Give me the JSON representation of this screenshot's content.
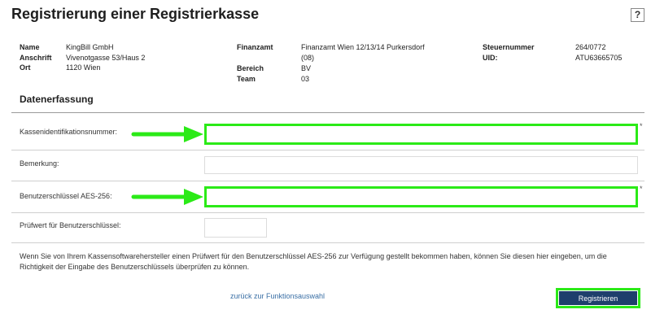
{
  "page": {
    "title": "Registrierung einer Registrierkasse",
    "help_label": "?"
  },
  "company": {
    "name_label": "Name",
    "name_value": "KingBill GmbH",
    "address_label": "Anschrift",
    "address_value": "Vivenotgasse 53/Haus 2",
    "city_label": "Ort",
    "city_value": "1120 Wien"
  },
  "office": {
    "finanzamt_label": "Finanzamt",
    "finanzamt_value_line1": "Finanzamt Wien 12/13/14 Purkersdorf",
    "finanzamt_value_line2": "(08)",
    "bereich_label": "Bereich",
    "bereich_value": "BV",
    "team_label": "Team",
    "team_value": "03"
  },
  "tax": {
    "steuernummer_label": "Steuernummer",
    "steuernummer_value": "264/0772",
    "uid_label": "UID:",
    "uid_value": "ATU63665705"
  },
  "form": {
    "section_title": "Datenerfassung",
    "fields": [
      {
        "label": "Kassenidentifikationsnummer:",
        "value": "",
        "required": true,
        "highlighted": true
      },
      {
        "label": "Bemerkung:",
        "value": "",
        "required": false,
        "highlighted": false
      },
      {
        "label": "Benutzerschlüssel AES-256:",
        "value": "",
        "required": true,
        "highlighted": true
      },
      {
        "label": "Prüfwert für Benutzerschlüssel:",
        "value": "",
        "required": false,
        "highlighted": false
      }
    ],
    "required_marker": "*",
    "hint": "Wenn Sie von Ihrem Kassensoftwarehersteller einen Prüfwert für den Benutzerschlüssel AES-256 zur Verfügung gestellt bekommen haben, können Sie diesen hier eingeben, um die Richtigkeit der Eingabe des Benutzerschlüssels überprüfen zu können."
  },
  "footer": {
    "back_link": "zurück zur Funktionsauswahl",
    "submit_label": "Registrieren"
  },
  "colors": {
    "highlight": "#2bea17",
    "submit_bg": "#1e3f6c",
    "link": "#3a6fa5"
  }
}
